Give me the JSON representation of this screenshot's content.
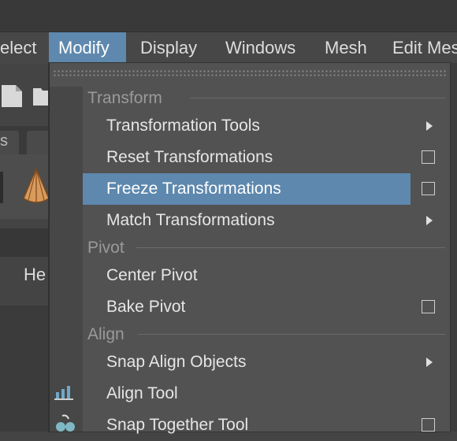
{
  "menubar": {
    "items": [
      {
        "label": "elect"
      },
      {
        "label": "Modify"
      },
      {
        "label": "Display"
      },
      {
        "label": "Windows"
      },
      {
        "label": "Mesh"
      },
      {
        "label": "Edit Mes"
      }
    ]
  },
  "background": {
    "partial_tab": "s",
    "partial_label": "He"
  },
  "menu": {
    "sections": [
      {
        "label": "Transform"
      },
      {
        "label": "Pivot"
      },
      {
        "label": "Align"
      }
    ],
    "items": [
      {
        "label": "Transformation Tools",
        "submenu": true
      },
      {
        "label": "Reset Transformations",
        "option_box": true
      },
      {
        "label": "Freeze Transformations",
        "option_box": true,
        "highlighted": true
      },
      {
        "label": "Match Transformations",
        "submenu": true
      },
      {
        "label": "Center Pivot"
      },
      {
        "label": "Bake Pivot",
        "option_box": true
      },
      {
        "label": "Snap Align Objects",
        "submenu": true
      },
      {
        "label": "Align Tool",
        "icon": "align-tool-icon"
      },
      {
        "label": "Snap Together Tool",
        "option_box": true,
        "icon": "snap-together-icon"
      }
    ]
  },
  "colors": {
    "highlight": "#5e88ad",
    "menu_bg": "#525252"
  }
}
